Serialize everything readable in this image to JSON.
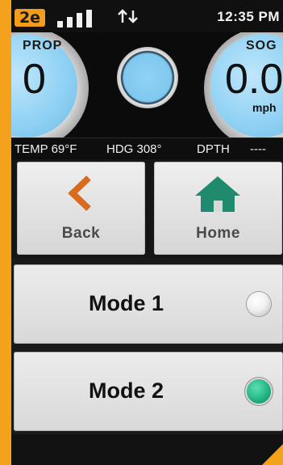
{
  "status": {
    "network": "2e",
    "time": "12:35 PM"
  },
  "gauges": {
    "left": {
      "label": "PROP",
      "value": "0"
    },
    "right": {
      "label": "SOG",
      "value": "0.0",
      "unit": "mph"
    }
  },
  "info": {
    "temp": "TEMP 69°F",
    "heading": "HDG 308°",
    "depth_label": "DPTH",
    "depth_value": "----"
  },
  "nav": {
    "back_label": "Back",
    "home_label": "Home"
  },
  "modes": [
    {
      "label": "Mode 1",
      "selected": false
    },
    {
      "label": "Mode 2",
      "selected": true
    }
  ],
  "colors": {
    "accent": "#f4a21b",
    "back_icon": "#d96b1e",
    "home_icon": "#1f8a6e",
    "radio_on": "#24b585",
    "gauge_face": "#8dd0f3"
  },
  "icons": {
    "back": "chevron-left-icon",
    "home": "house-icon",
    "signal": "signal-bars-icon",
    "data": "up-down-arrows-icon"
  }
}
